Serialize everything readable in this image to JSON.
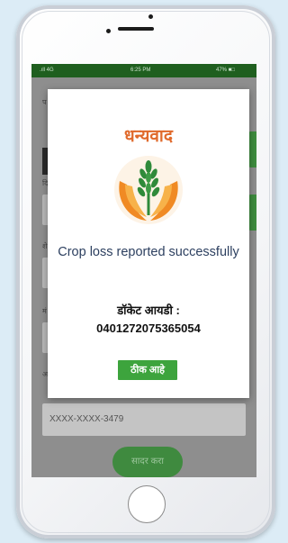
{
  "status_bar": {
    "network": ".ıll 4G",
    "time": "6:25 PM",
    "battery": "47% ■□"
  },
  "background_form": {
    "aadhaar_value": "XXXX-XXXX-3479",
    "submit_label": "सादर करा"
  },
  "dialog": {
    "title": "धन्यवाद",
    "logo_icon": "wheat-sheaf-in-hands-icon",
    "message": "Crop loss reported successfully",
    "docket_label": "डॉकेट आयडी :",
    "docket_id": "0401272075365054",
    "ok_label": "ठीक आहे"
  },
  "colors": {
    "title_orange": "#e06a2c",
    "message_navy": "#2d4060",
    "button_green": "#3da43d",
    "statusbar_green": "#1f5f1f"
  }
}
